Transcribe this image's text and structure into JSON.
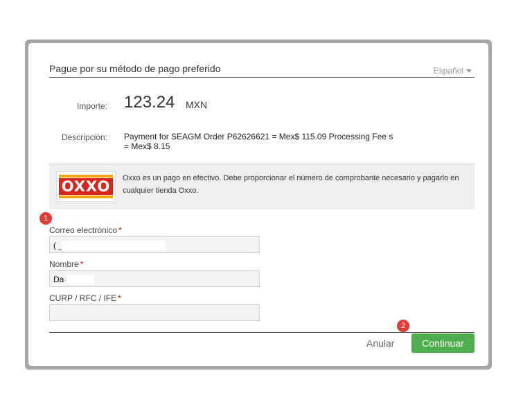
{
  "header": {
    "title": "Pague por su método de pago preferido",
    "language": "Español"
  },
  "importe": {
    "label": "Importe:",
    "amount": "123.24",
    "currency": "MXN"
  },
  "descripcion": {
    "label": "Descripción:",
    "text": "Payment for SEAGM Order P62626621 = Mex$ 115.09 Processing Fee s = Mex$ 8.15"
  },
  "oxxo": {
    "logo_text": "OXXO",
    "info": "Oxxo es un pago en efectivo. Debe proporcionar el número de comprobante necesario y pagarlo en cualquier tienda Oxxo."
  },
  "badges": {
    "first": "1",
    "second": "2"
  },
  "form": {
    "email": {
      "label": "Correo electrónico",
      "required": "*",
      "value": "(            _"
    },
    "name": {
      "label": "Nombre",
      "required": "*",
      "value": "Da"
    },
    "curp": {
      "label": "CURP / RFC / IFE",
      "required": "*",
      "value": ""
    }
  },
  "footer": {
    "cancel_label": "Anular",
    "continue_label": "Continuar"
  },
  "colors": {
    "continue_button": "#4cae4c",
    "badge": "#e53935",
    "oxxo_red": "#d9261c",
    "oxxo_yellow": "#f5a400"
  }
}
